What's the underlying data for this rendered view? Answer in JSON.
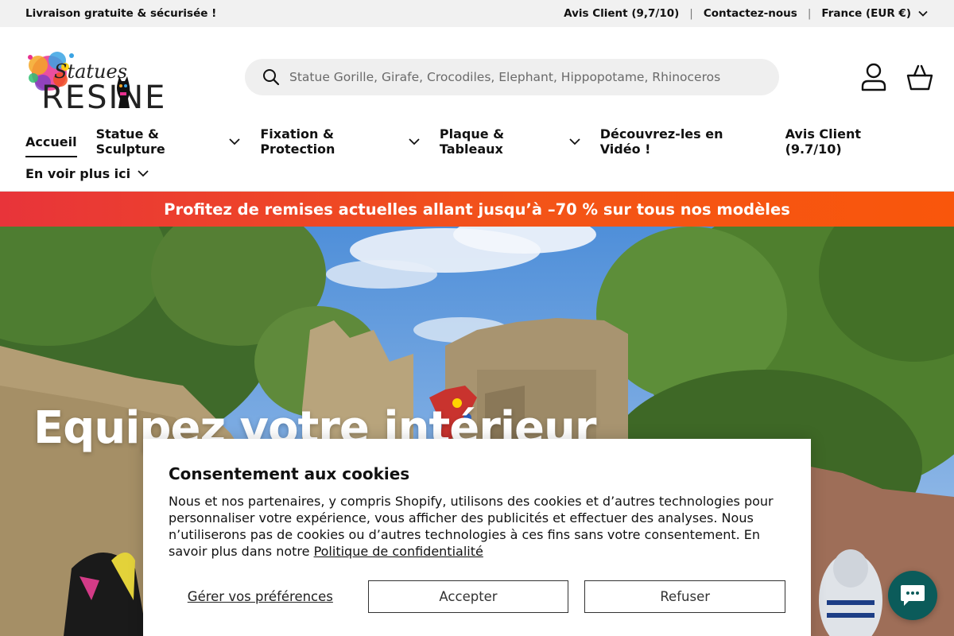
{
  "topbar": {
    "promo": "Livraison gratuite & sécurisée !",
    "reviews": "Avis Client (9,7/10)",
    "contact": "Contactez-nous",
    "country": "France (EUR €)",
    "separator": "|"
  },
  "logo": {
    "script_text": "Statues",
    "wordmark": "RESINE"
  },
  "search": {
    "placeholder": "Statue Gorille, Girafe, Crocodiles, Elephant, Hippopotame, Rhinoceros"
  },
  "header_icons": [
    "account-icon",
    "cart-icon"
  ],
  "nav": {
    "items": [
      {
        "label": "Accueil",
        "dropdown": false,
        "active": true
      },
      {
        "label": "Statue & Sculpture",
        "dropdown": true
      },
      {
        "label": "Fixation & Protection",
        "dropdown": true
      },
      {
        "label": "Plaque & Tableaux",
        "dropdown": true
      },
      {
        "label": "Découvrez-les en Vidéo !",
        "dropdown": false
      },
      {
        "label": "Avis Client (9.7/10)",
        "dropdown": false
      },
      {
        "label": "En voir plus ici",
        "dropdown": true
      }
    ]
  },
  "promo_banner": {
    "text": "Profitez de remises actuelles allant jusqu’à –70 % sur tous nos modèles"
  },
  "hero": {
    "title": "Equipez votre intérieur"
  },
  "cookie": {
    "title": "Consentement aux cookies",
    "body": "Nous et nos partenaires, y compris Shopify, utilisons des cookies et d’autres technologies pour personnaliser votre expérience, vous afficher des publicités et effectuer des analyses. Nous n’utiliserons pas de cookies ou d’autres technologies à ces fins sans votre consentement. En savoir plus dans notre ",
    "policy_link": "Politique de confidentialité",
    "manage_label": "Gérer vos préférences",
    "accept_label": "Accepter",
    "reject_label": "Refuser"
  },
  "colors": {
    "promo_start": "#e8343a",
    "promo_end": "#f9560b",
    "chat": "#0b5b5a",
    "topbar_bg": "#f1f1f1"
  },
  "chat": {
    "icon": "chat-bubble-icon"
  }
}
